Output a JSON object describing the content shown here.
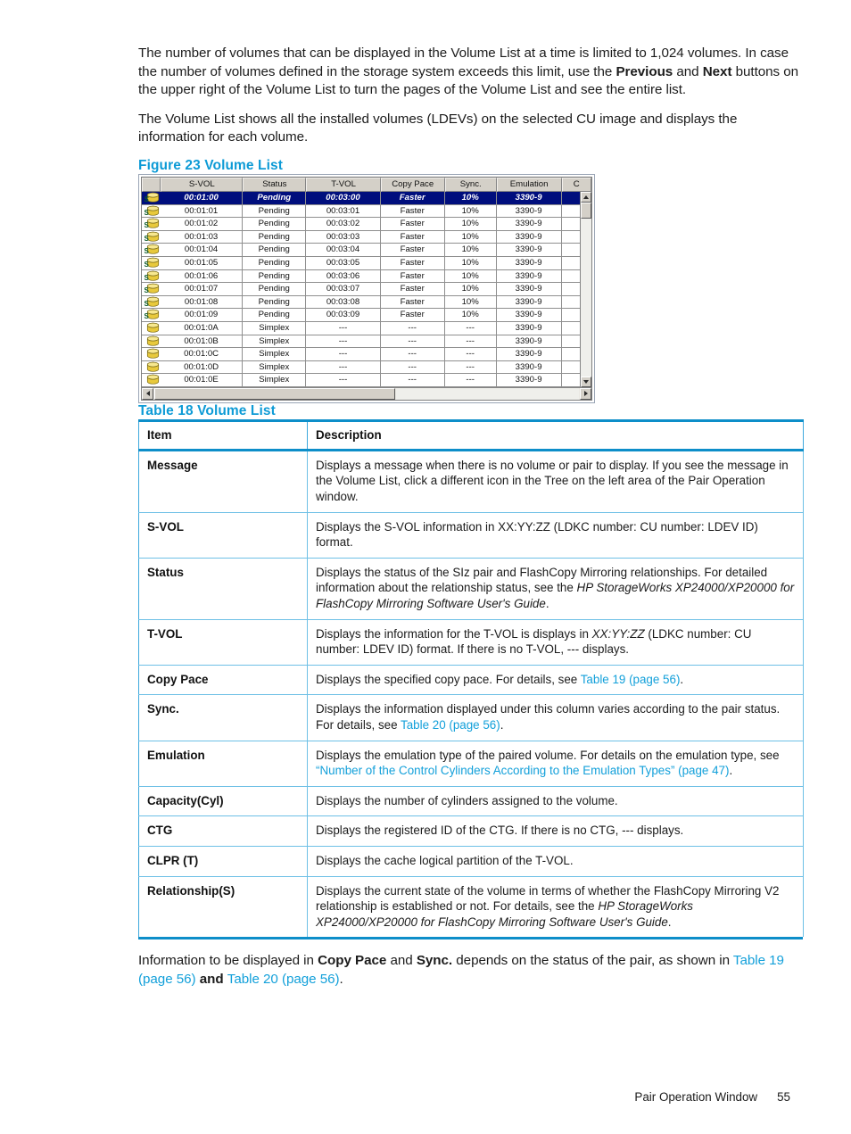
{
  "intro": {
    "para1_a": "The number of volumes that can be displayed in the Volume List at a time is limited to 1,024 volumes. In case the number of volumes defined in the storage system exceeds this limit, use the ",
    "para1_b": "Previous",
    "para1_c": " and ",
    "para1_d": "Next",
    "para1_e": " buttons on the upper right of the Volume List to turn the pages of the Volume List and see the entire list.",
    "para2": "The Volume List shows all the installed volumes (LDEVs) on the selected CU image and displays the information for each volume."
  },
  "figure": {
    "caption": "Figure 23 Volume List",
    "columns": [
      "S-VOL",
      "Status",
      "T-VOL",
      "Copy Pace",
      "Sync.",
      "Emulation",
      "C"
    ],
    "rows": [
      {
        "icon": "volume-s-vol-icon",
        "svol": "00:01:00",
        "status": "Pending",
        "tvol": "00:03:00",
        "pace": "Faster",
        "sync": "10%",
        "emulation": "3390-9",
        "c": "",
        "selected": true
      },
      {
        "icon": "volume-s-vol-icon",
        "svol": "00:01:01",
        "status": "Pending",
        "tvol": "00:03:01",
        "pace": "Faster",
        "sync": "10%",
        "emulation": "3390-9",
        "c": "",
        "selected": false
      },
      {
        "icon": "volume-s-vol-icon",
        "svol": "00:01:02",
        "status": "Pending",
        "tvol": "00:03:02",
        "pace": "Faster",
        "sync": "10%",
        "emulation": "3390-9",
        "c": "",
        "selected": false
      },
      {
        "icon": "volume-s-vol-icon",
        "svol": "00:01:03",
        "status": "Pending",
        "tvol": "00:03:03",
        "pace": "Faster",
        "sync": "10%",
        "emulation": "3390-9",
        "c": "",
        "selected": false
      },
      {
        "icon": "volume-s-vol-icon",
        "svol": "00:01:04",
        "status": "Pending",
        "tvol": "00:03:04",
        "pace": "Faster",
        "sync": "10%",
        "emulation": "3390-9",
        "c": "",
        "selected": false
      },
      {
        "icon": "volume-s-vol-icon",
        "svol": "00:01:05",
        "status": "Pending",
        "tvol": "00:03:05",
        "pace": "Faster",
        "sync": "10%",
        "emulation": "3390-9",
        "c": "",
        "selected": false
      },
      {
        "icon": "volume-s-vol-icon",
        "svol": "00:01:06",
        "status": "Pending",
        "tvol": "00:03:06",
        "pace": "Faster",
        "sync": "10%",
        "emulation": "3390-9",
        "c": "",
        "selected": false
      },
      {
        "icon": "volume-s-vol-icon",
        "svol": "00:01:07",
        "status": "Pending",
        "tvol": "00:03:07",
        "pace": "Faster",
        "sync": "10%",
        "emulation": "3390-9",
        "c": "",
        "selected": false
      },
      {
        "icon": "volume-s-vol-icon",
        "svol": "00:01:08",
        "status": "Pending",
        "tvol": "00:03:08",
        "pace": "Faster",
        "sync": "10%",
        "emulation": "3390-9",
        "c": "",
        "selected": false
      },
      {
        "icon": "volume-s-vol-icon",
        "svol": "00:01:09",
        "status": "Pending",
        "tvol": "00:03:09",
        "pace": "Faster",
        "sync": "10%",
        "emulation": "3390-9",
        "c": "",
        "selected": false
      },
      {
        "icon": "volume-simplex-icon",
        "svol": "00:01:0A",
        "status": "Simplex",
        "tvol": "---",
        "pace": "---",
        "sync": "---",
        "emulation": "3390-9",
        "c": "",
        "selected": false
      },
      {
        "icon": "volume-simplex-icon",
        "svol": "00:01:0B",
        "status": "Simplex",
        "tvol": "---",
        "pace": "---",
        "sync": "---",
        "emulation": "3390-9",
        "c": "",
        "selected": false
      },
      {
        "icon": "volume-simplex-icon",
        "svol": "00:01:0C",
        "status": "Simplex",
        "tvol": "---",
        "pace": "---",
        "sync": "---",
        "emulation": "3390-9",
        "c": "",
        "selected": false
      },
      {
        "icon": "volume-simplex-icon",
        "svol": "00:01:0D",
        "status": "Simplex",
        "tvol": "---",
        "pace": "---",
        "sync": "---",
        "emulation": "3390-9",
        "c": "",
        "selected": false
      },
      {
        "icon": "volume-simplex-icon",
        "svol": "00:01:0E",
        "status": "Simplex",
        "tvol": "---",
        "pace": "---",
        "sync": "---",
        "emulation": "3390-9",
        "c": "",
        "selected": false
      }
    ]
  },
  "table18": {
    "caption": "Table 18 Volume List",
    "headers": [
      "Item",
      "Description"
    ],
    "rows": [
      {
        "item": "Message",
        "desc": "Displays a message when there is no volume or pair to display. If you see the message in the Volume List, click a different icon in the Tree on the left area of the Pair Operation window."
      },
      {
        "item": "S-VOL",
        "desc": "Displays the S-VOL information in XX:YY:ZZ (LDKC number: CU number: LDEV ID) format."
      },
      {
        "item": "Status",
        "desc_a": "Displays the status of the SIz pair and FlashCopy Mirroring relationships. For detailed information about the relationship status, see the ",
        "desc_italic": "HP StorageWorks XP24000/XP20000 for FlashCopy Mirroring Software User's Guide",
        "desc_b": "."
      },
      {
        "item": "T-VOL",
        "desc_a": "Displays the information for the T-VOL is displays in ",
        "desc_italic": "XX:YY:ZZ",
        "desc_b": " (LDKC number: CU number: LDEV ID) format. If there is no T-VOL, --- displays."
      },
      {
        "item": "Copy Pace",
        "desc_a": "Displays the specified copy pace. For details, see ",
        "desc_link": "Table 19 (page 56)",
        "desc_b": "."
      },
      {
        "item": "Sync.",
        "desc_a": "Displays the information displayed under this column varies according to the pair status. For details, see ",
        "desc_link": "Table 20 (page 56)",
        "desc_b": "."
      },
      {
        "item": "Emulation",
        "desc_a": "Displays the emulation type of the paired volume. For details on the emulation type, see ",
        "desc_link": "“Number of the Control Cylinders According to the Emulation Types” (page 47)",
        "desc_b": "."
      },
      {
        "item": "Capacity(Cyl)",
        "desc": "Displays the number of cylinders assigned to the volume."
      },
      {
        "item": "CTG",
        "desc": "Displays the registered ID of the CTG. If there is no CTG, --- displays."
      },
      {
        "item": "CLPR (T)",
        "desc": "Displays the cache logical partition of the T-VOL."
      },
      {
        "item": "Relationship(S)",
        "desc_a": "Displays the current state of the volume in terms of whether the FlashCopy Mirroring V2 relationship is established or not. For details, see the ",
        "desc_italic": "HP StorageWorks XP24000/XP20000 for FlashCopy Mirroring Software User's Guide",
        "desc_b": "."
      }
    ]
  },
  "outro": {
    "a": "Information to be displayed in ",
    "b": "Copy Pace",
    "c": " and ",
    "d": "Sync.",
    "e": " depends on the status of the pair, as shown in ",
    "link1": "Table 19 (page 56)",
    "f": " and ",
    "link2": "Table 20 (page 56)",
    "g": "."
  },
  "footer": {
    "chapter": "Pair Operation Window",
    "page": "55"
  },
  "colors": {
    "heading_blue": "#0e9bd6",
    "link_blue": "#13a0da",
    "table_rule": "#0d8ec9",
    "table_hairline": "#6ec0e6",
    "selection_navy": "#000e7d",
    "win_gray": "#d4d0c8"
  }
}
